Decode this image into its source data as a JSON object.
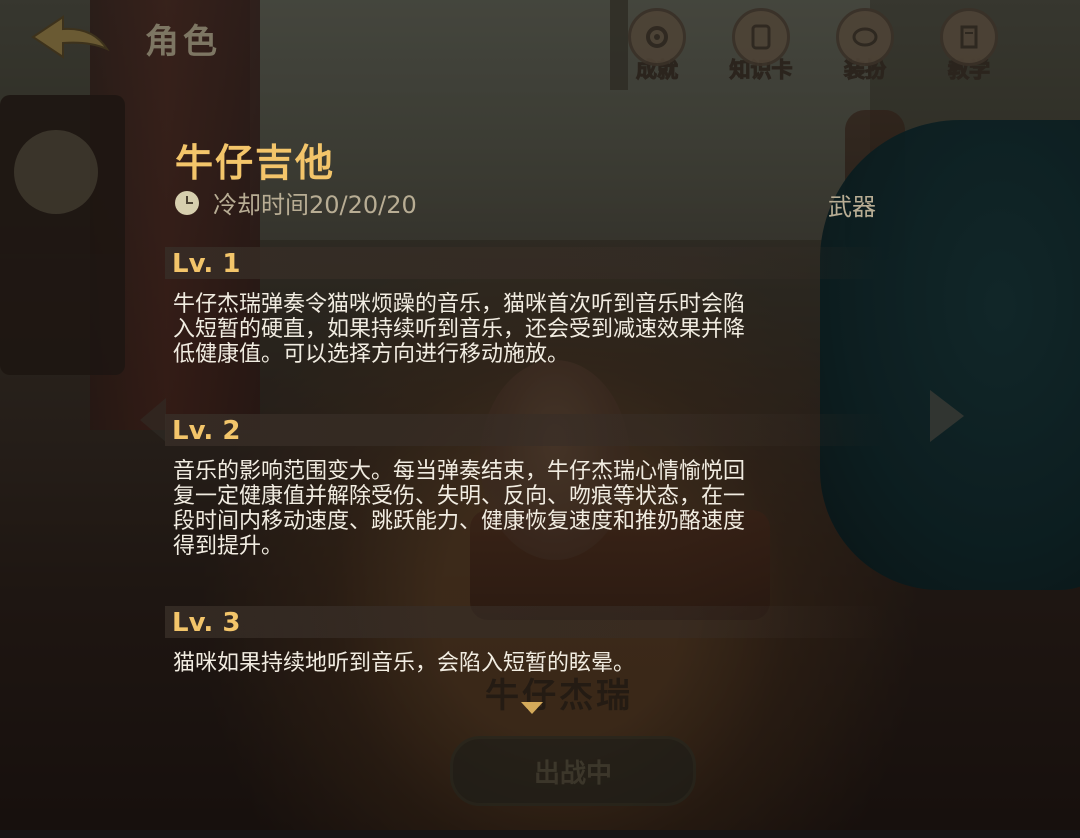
{
  "nav": {
    "back_icon": "back-arrow-icon",
    "title": "角色"
  },
  "top_menu": [
    {
      "label": "成就",
      "icon": "achievement-icon"
    },
    {
      "label": "知识卡",
      "icon": "knowledge-card-icon"
    },
    {
      "label": "装扮",
      "icon": "outfit-icon"
    },
    {
      "label": "教学",
      "icon": "tutorial-icon"
    }
  ],
  "skill": {
    "name": "牛仔吉他",
    "cooldown": "冷却时间20/20/20",
    "type": "武器"
  },
  "levels": [
    {
      "label": "Lv. 1",
      "lines": [
        "牛仔杰瑞弹奏令猫咪烦躁的音乐，猫咪首次听到音乐时会陷",
        "入短暂的硬直，如果持续听到音乐，还会受到减速效果并降",
        "低健康值。可以选择方向进行移动施放。"
      ]
    },
    {
      "label": "Lv. 2",
      "lines": [
        "音乐的影响范围变大。每当弹奏结束，牛仔杰瑞心情愉悦回",
        "复一定健康值并解除受伤、失明、反向、吻痕等状态，在一",
        "段时间内移动速度、跳跃能力、健康恢复速度和推奶酪速度",
        "得到提升。"
      ]
    },
    {
      "label": "Lv. 3",
      "lines": [
        "猫咪如果持续地听到音乐，会陷入短暂的眩晕。"
      ]
    }
  ],
  "background": {
    "character_name": "牛仔杰瑞",
    "deploy_button": "出战中"
  },
  "colors": {
    "accent_gold": "#f3c56a",
    "text_light": "#f1ece1",
    "text_muted": "#b8ad94"
  }
}
